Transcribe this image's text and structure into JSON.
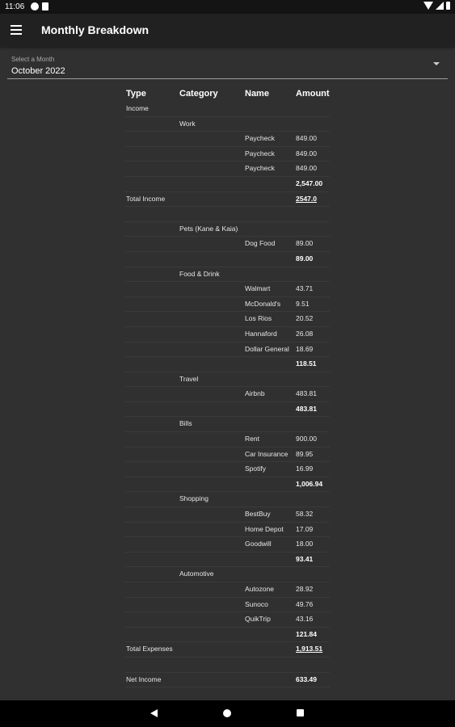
{
  "status_bar": {
    "time": "11:06"
  },
  "app_bar": {
    "title": "Monthly Breakdown",
    "menu_icon": "hamburger-menu-icon"
  },
  "month_select": {
    "label": "Select a Month",
    "value": "October 2022",
    "icon": "dropdown-arrow-icon"
  },
  "table": {
    "headers": [
      "Type",
      "Category",
      "Name",
      "Amount"
    ],
    "rows": [
      {
        "type": "Income",
        "category": "",
        "name": "",
        "amount": "",
        "style": ""
      },
      {
        "type": "",
        "category": "Work",
        "name": "",
        "amount": "",
        "style": ""
      },
      {
        "type": "",
        "category": "",
        "name": "Paycheck",
        "amount": "849.00",
        "style": ""
      },
      {
        "type": "",
        "category": "",
        "name": "Paycheck",
        "amount": "849.00",
        "style": ""
      },
      {
        "type": "",
        "category": "",
        "name": "Paycheck",
        "amount": "849.00",
        "style": ""
      },
      {
        "type": "",
        "category": "",
        "name": "",
        "amount": "2,547.00",
        "style": "b"
      },
      {
        "type": "Total Income",
        "category": "",
        "name": "",
        "amount": "2547.0",
        "style": "u"
      },
      {
        "type": "",
        "category": "",
        "name": "",
        "amount": "",
        "style": ""
      },
      {
        "type": "",
        "category": "Pets (Kane & Kaia)",
        "name": "",
        "amount": "",
        "style": ""
      },
      {
        "type": "",
        "category": "",
        "name": "Dog Food",
        "amount": "89.00",
        "style": ""
      },
      {
        "type": "",
        "category": "",
        "name": "",
        "amount": "89.00",
        "style": "b"
      },
      {
        "type": "",
        "category": "Food & Drink",
        "name": "",
        "amount": "",
        "style": ""
      },
      {
        "type": "",
        "category": "",
        "name": "Walmart",
        "amount": "43.71",
        "style": ""
      },
      {
        "type": "",
        "category": "",
        "name": "McDonald's",
        "amount": "9.51",
        "style": ""
      },
      {
        "type": "",
        "category": "",
        "name": "Los Rios",
        "amount": "20.52",
        "style": ""
      },
      {
        "type": "",
        "category": "",
        "name": "Hannaford",
        "amount": "26.08",
        "style": ""
      },
      {
        "type": "",
        "category": "",
        "name": "Dollar General",
        "amount": "18.69",
        "style": ""
      },
      {
        "type": "",
        "category": "",
        "name": "",
        "amount": "118.51",
        "style": "b"
      },
      {
        "type": "",
        "category": "Travel",
        "name": "",
        "amount": "",
        "style": ""
      },
      {
        "type": "",
        "category": "",
        "name": "Airbnb",
        "amount": "483.81",
        "style": ""
      },
      {
        "type": "",
        "category": "",
        "name": "",
        "amount": "483.81",
        "style": "b"
      },
      {
        "type": "",
        "category": "Bills",
        "name": "",
        "amount": "",
        "style": ""
      },
      {
        "type": "",
        "category": "",
        "name": "Rent",
        "amount": "900.00",
        "style": ""
      },
      {
        "type": "",
        "category": "",
        "name": "Car Insurance",
        "amount": "89.95",
        "style": ""
      },
      {
        "type": "",
        "category": "",
        "name": "Spotify",
        "amount": "16.99",
        "style": ""
      },
      {
        "type": "",
        "category": "",
        "name": "",
        "amount": "1,006.94",
        "style": "b"
      },
      {
        "type": "",
        "category": "Shopping",
        "name": "",
        "amount": "",
        "style": ""
      },
      {
        "type": "",
        "category": "",
        "name": "BestBuy",
        "amount": "58.32",
        "style": ""
      },
      {
        "type": "",
        "category": "",
        "name": "Home Depot",
        "amount": "17.09",
        "style": ""
      },
      {
        "type": "",
        "category": "",
        "name": "Goodwill",
        "amount": "18.00",
        "style": ""
      },
      {
        "type": "",
        "category": "",
        "name": "",
        "amount": "93.41",
        "style": "b"
      },
      {
        "type": "",
        "category": "Automotive",
        "name": "",
        "amount": "",
        "style": ""
      },
      {
        "type": "",
        "category": "",
        "name": "Autozone",
        "amount": "28.92",
        "style": ""
      },
      {
        "type": "",
        "category": "",
        "name": "Sunoco",
        "amount": "49.76",
        "style": ""
      },
      {
        "type": "",
        "category": "",
        "name": "QuikTrip",
        "amount": "43.16",
        "style": ""
      },
      {
        "type": "",
        "category": "",
        "name": "",
        "amount": "121.84",
        "style": "b"
      },
      {
        "type": "Total Expenses",
        "category": "",
        "name": "",
        "amount": "1,913.51",
        "style": "u"
      },
      {
        "type": "",
        "category": "",
        "name": "",
        "amount": "",
        "style": ""
      },
      {
        "type": "Net Income",
        "category": "",
        "name": "",
        "amount": "633.49",
        "style": "b"
      }
    ]
  },
  "nav_bar": {
    "back_icon": "back-icon",
    "home_icon": "home-icon",
    "recents_icon": "recents-icon"
  },
  "colors": {
    "background": "#303030",
    "app_bar": "#212121",
    "status_bar": "#141414",
    "nav_bar": "#000000",
    "text": "#e6e6e6"
  }
}
